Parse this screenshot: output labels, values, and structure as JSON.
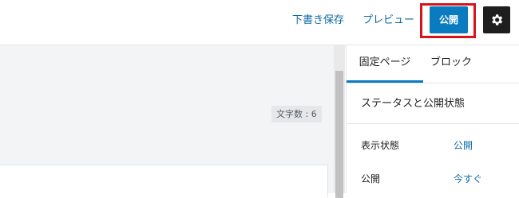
{
  "toolbar": {
    "save_draft_label": "下書き保存",
    "preview_label": "プレビュー",
    "publish_label": "公開",
    "settings_icon": "gear-icon"
  },
  "editor": {
    "word_count": "文字数 : 6"
  },
  "sidebar": {
    "tabs": [
      {
        "label": "固定ページ",
        "active": true
      },
      {
        "label": "ブロック",
        "active": false
      }
    ],
    "status_section": {
      "title": "ステータスと公開状態",
      "rows": [
        {
          "label": "表示状態",
          "value": "公開"
        },
        {
          "label": "公開",
          "value": "今すぐ"
        }
      ]
    }
  },
  "colors": {
    "accent": "#0a7bbf",
    "link": "#0b6aa2",
    "highlight_border": "#d7141e",
    "settings_bg": "#1e1e1e"
  }
}
